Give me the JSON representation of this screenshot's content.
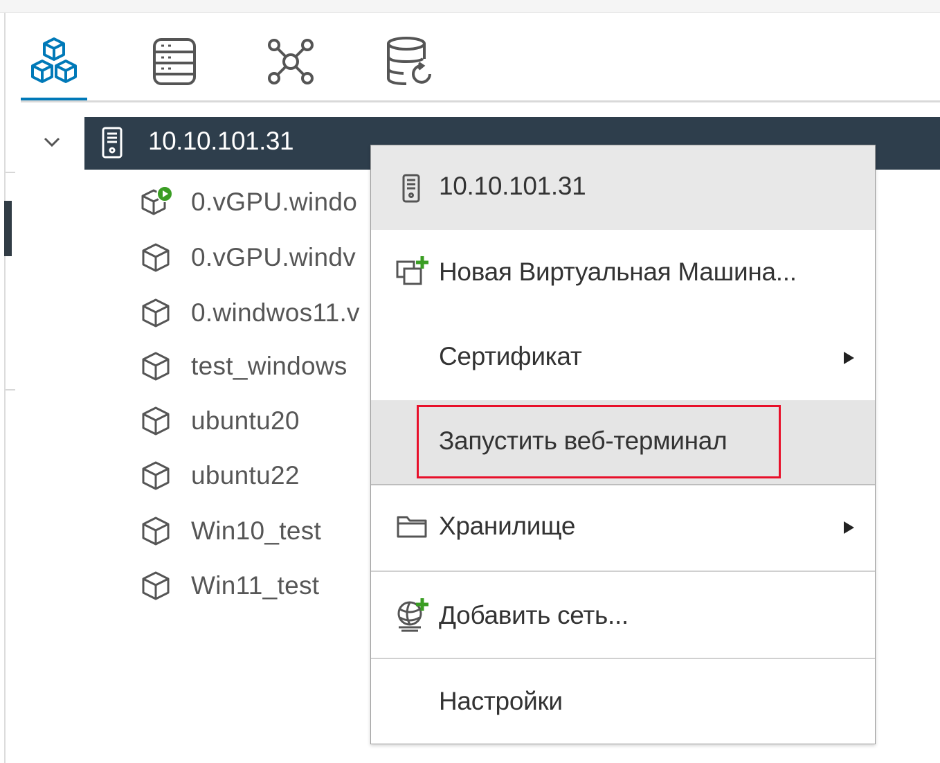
{
  "tabs": [
    {
      "icon": "hosts-clusters-icon",
      "active": true
    },
    {
      "icon": "storage-icon",
      "active": false
    },
    {
      "icon": "networking-icon",
      "active": false
    },
    {
      "icon": "storage-backup-icon",
      "active": false
    }
  ],
  "host": {
    "label": "10.10.101.31",
    "icon": "server-icon",
    "expanded": true
  },
  "vms": [
    {
      "name": "0.vGPU.windo",
      "icon": "vm-powered-on-icon"
    },
    {
      "name": "0.vGPU.windv",
      "icon": "vm-icon"
    },
    {
      "name": "0.windwos11.v",
      "icon": "vm-icon"
    },
    {
      "name": "test_windows",
      "icon": "vm-icon"
    },
    {
      "name": "ubuntu20",
      "icon": "vm-icon"
    },
    {
      "name": "ubuntu22",
      "icon": "vm-icon"
    },
    {
      "name": "Win10_test",
      "icon": "vm-icon"
    },
    {
      "name": "Win11_test",
      "icon": "vm-icon"
    }
  ],
  "context_menu": {
    "header": "10.10.101.31",
    "new_vm": "Новая Виртуальная Машина...",
    "certificate": "Сертификат",
    "web_terminal": "Запустить веб-терминал",
    "storage": "Хранилище",
    "add_network": "Добавить сеть...",
    "settings": "Настройки"
  },
  "colors": {
    "accent": "#0079b8",
    "selected_row": "#2e3e4c",
    "menu_header": "#e8e8e8",
    "menu_hover": "#e5e5e5",
    "highlight_box": "#e8102a",
    "add_plus": "#3a9d23",
    "powered_on": "#3a9d23"
  }
}
